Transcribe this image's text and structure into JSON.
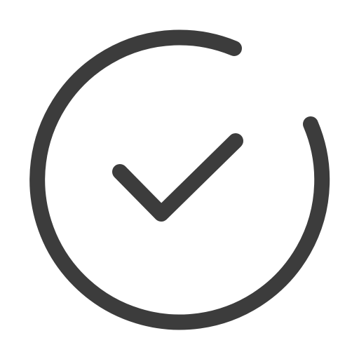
{
  "icon": {
    "name": "circle-check-icon",
    "stroke_color": "#3c3c3c",
    "background_color": "#ffffff"
  }
}
